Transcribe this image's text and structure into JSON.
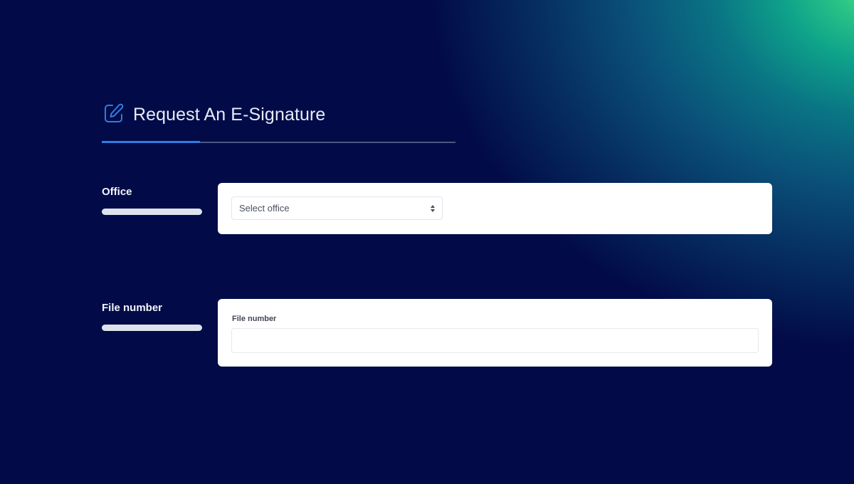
{
  "page": {
    "title": "Request An E-Signature",
    "title_icon": "edit-icon",
    "accent_color": "#2f7de1"
  },
  "office": {
    "label": "Office",
    "select_placeholder": "Select office",
    "select_icon": "sort-arrows-icon"
  },
  "file_number": {
    "label": "File number",
    "field_label": "File number",
    "value": "",
    "placeholder": ""
  }
}
